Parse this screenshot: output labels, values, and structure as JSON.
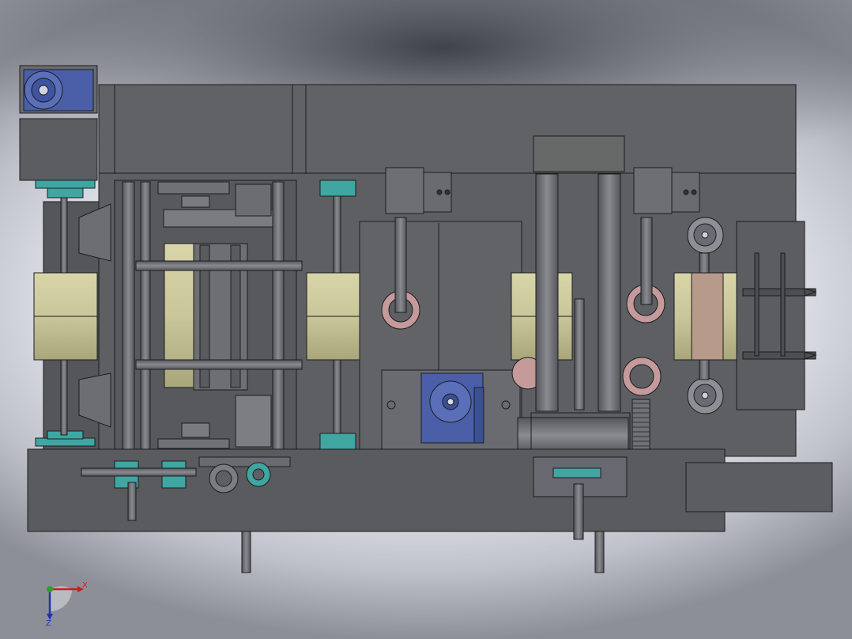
{
  "triad": {
    "x_label": "X",
    "z_label": "Z"
  },
  "colors": {
    "frame": "#5e5f63",
    "frame_dark": "#4a4b4f",
    "edge": "#1c1c1e",
    "roller": "#c9c79a",
    "roller_shade": "#a9a77c",
    "roller_pink": "#b89a8a",
    "motor_blue": "#4a5fa8",
    "teal": "#3fa6a2",
    "pink_ring": "#c59a9a",
    "shaft": "#6c6d72"
  }
}
